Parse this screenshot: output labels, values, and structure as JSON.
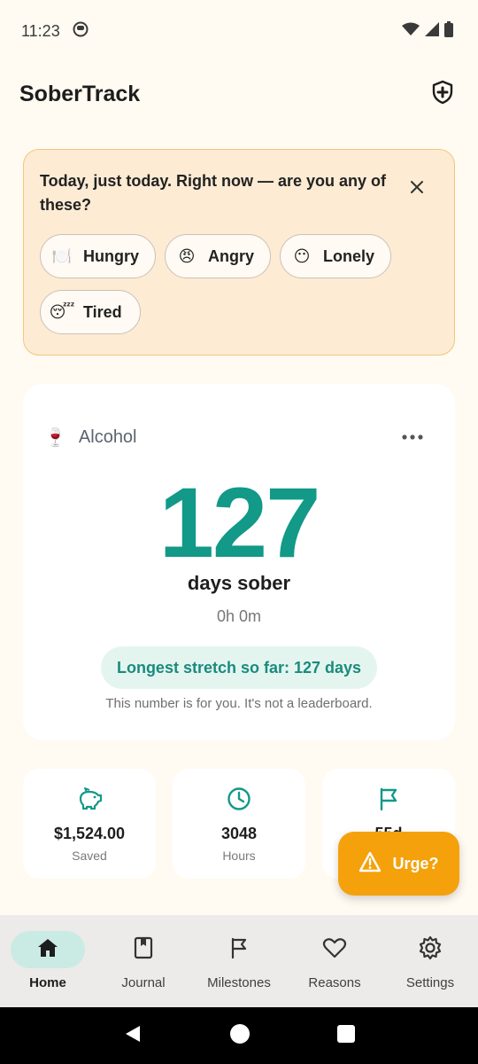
{
  "status_bar": {
    "time": "11:23"
  },
  "app": {
    "title": "SoberTrack"
  },
  "halt_prompt": {
    "question": "Today, just today. Right now — are you any of these?",
    "chips": [
      {
        "label": "Hungry",
        "emoji": "🍽️"
      },
      {
        "label": "Angry",
        "emoji": "😠"
      },
      {
        "label": "Lonely",
        "emoji": "😶"
      },
      {
        "label": "Tired",
        "emoji": "😴"
      }
    ]
  },
  "counter": {
    "habit_emoji": "🍷",
    "habit_name": "Alcohol",
    "days": "127",
    "days_label": "days sober",
    "time": "0h 0m",
    "longest": "Longest stretch so far: 127 days",
    "note": "This number is for you. It's not a leaderboard."
  },
  "stats": [
    {
      "value": "$1,524.00",
      "label": "Saved",
      "icon": "piggy-bank-icon"
    },
    {
      "value": "3048",
      "label": "Hours",
      "icon": "clock-icon"
    },
    {
      "value": "55d",
      "label": "",
      "icon": "flag-icon"
    }
  ],
  "fab": {
    "label": "Urge?"
  },
  "nav": {
    "items": [
      {
        "label": "Home",
        "icon": "home-icon",
        "active": true
      },
      {
        "label": "Journal",
        "icon": "journal-icon"
      },
      {
        "label": "Milestones",
        "icon": "flag-icon"
      },
      {
        "label": "Reasons",
        "icon": "heart-icon"
      },
      {
        "label": "Settings",
        "icon": "gear-icon"
      }
    ]
  },
  "colors": {
    "accent": "#129988",
    "warning": "#f5a10b",
    "prompt_bg": "#fdebd4"
  }
}
